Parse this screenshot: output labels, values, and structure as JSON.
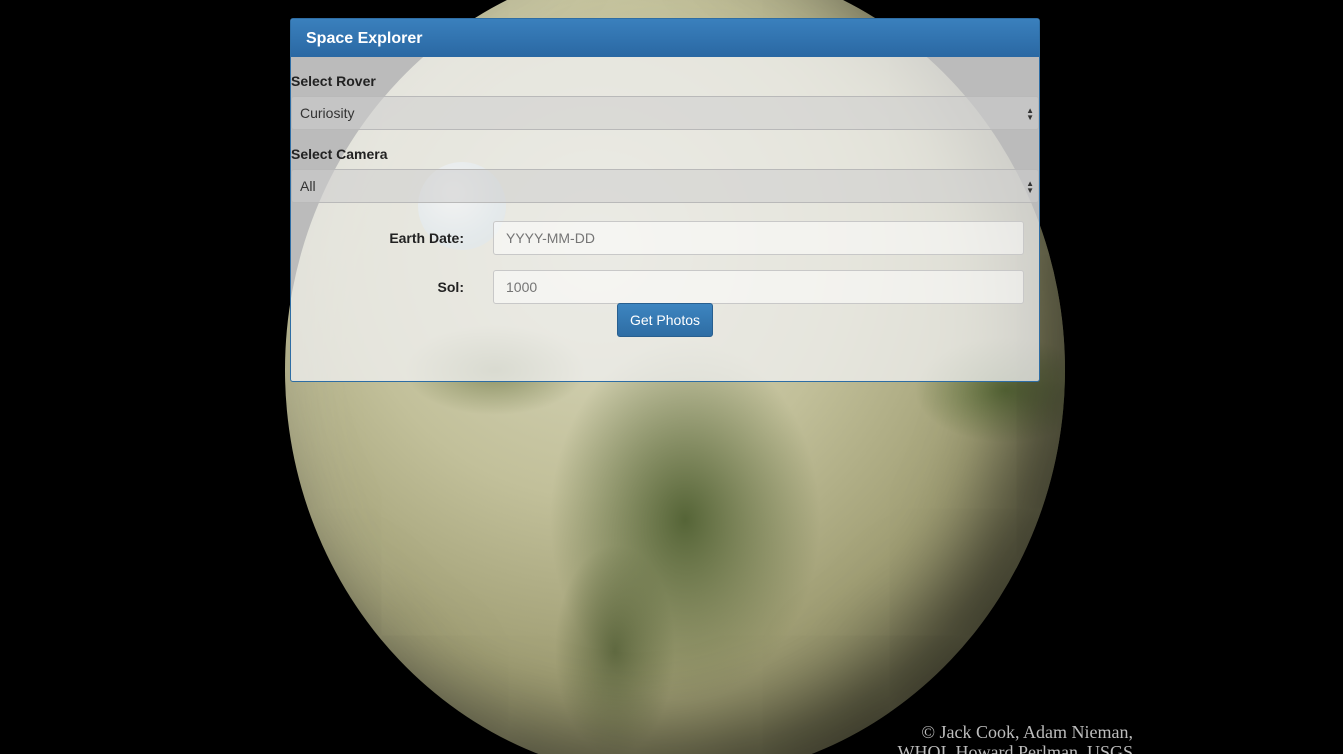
{
  "panel": {
    "title": "Space Explorer"
  },
  "rover": {
    "label": "Select Rover",
    "selected": "Curiosity"
  },
  "camera": {
    "label": "Select Camera",
    "selected": "All"
  },
  "earth_date": {
    "label": "Earth Date:",
    "placeholder": "YYYY-MM-DD",
    "value": ""
  },
  "sol": {
    "label": "Sol:",
    "placeholder": "1000",
    "value": ""
  },
  "submit": {
    "label": "Get Photos"
  },
  "credit": {
    "line1": "© Jack Cook, Adam Nieman,",
    "line2": "WHOI, Howard Perlman, USGS"
  },
  "colors": {
    "heading_bg": "#2a68a3",
    "button_bg": "#2e6da4",
    "page_bg": "#000000"
  }
}
